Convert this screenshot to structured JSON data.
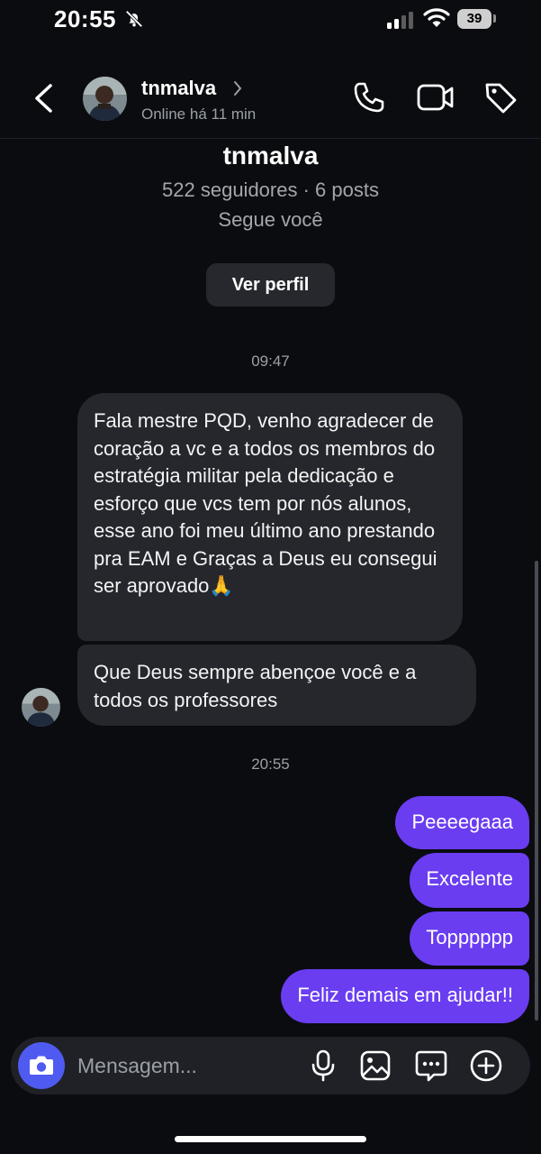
{
  "status_bar": {
    "time": "20:55",
    "battery": "39"
  },
  "header": {
    "username": "tnmalva",
    "status": "Online há 11 min"
  },
  "profile": {
    "name": "tnmalva",
    "stats": "522 seguidores · 6 posts",
    "follow_status": "Segue você",
    "view_profile_label": "Ver perfil"
  },
  "messages": {
    "time_1": "09:47",
    "incoming_1": "Fala mestre PQD, venho agradecer de coração a vc e a todos os membros do estratégia militar pela dedicação e esforço que vcs tem por nós alunos, esse ano foi meu último ano prestando pra EAM e Graças a Deus eu consegui ser aprovado🙏",
    "incoming_2": "Que Deus sempre abençoe você e a todos os professores",
    "time_2": "20:55",
    "outgoing": [
      "Peeeegaaa",
      "Excelente",
      "Topppppp",
      "Feliz demais em ajudar!!"
    ]
  },
  "composer": {
    "placeholder": "Mensagem..."
  },
  "colors": {
    "background": "#0b0c10",
    "incoming_bubble": "#25272d",
    "outgoing_bubble": "#6a3df1",
    "camera_button": "#4f5bf0"
  },
  "icons": [
    "bell-slash-icon",
    "signal-icon",
    "wifi-icon",
    "back-icon",
    "chevron-right-icon",
    "phone-icon",
    "video-icon",
    "tag-icon",
    "camera-icon",
    "microphone-icon",
    "gallery-icon",
    "sticker-icon",
    "plus-icon"
  ]
}
